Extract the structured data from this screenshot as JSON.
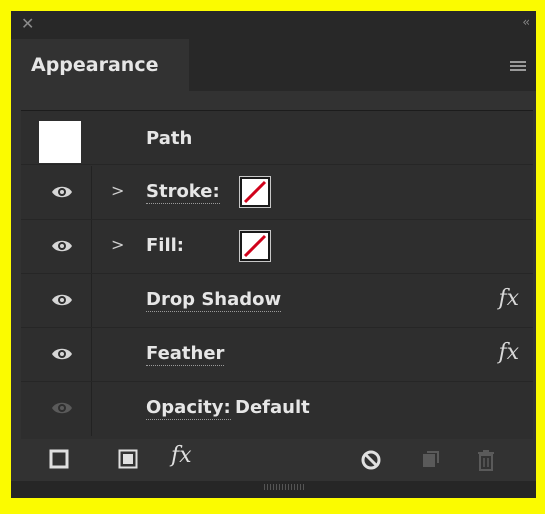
{
  "window": {
    "close_glyph": "✕",
    "collapse_glyph": "‹‹"
  },
  "panel": {
    "tab_label": "Appearance",
    "menu_icon": "hamburger-icon"
  },
  "items": {
    "path": {
      "label": "Path"
    },
    "stroke": {
      "label": "Stroke:",
      "swatch": "none"
    },
    "fill": {
      "label": "Fill:",
      "swatch": "none"
    },
    "drop_shadow": {
      "label": "Drop Shadow",
      "fx": "fx"
    },
    "feather": {
      "label": "Feather",
      "fx": "fx"
    },
    "opacity": {
      "label": "Opacity:",
      "value": "Default"
    }
  },
  "footer": {
    "icons": [
      "add-new-stroke-icon",
      "add-new-fill-icon",
      "add-new-effect-icon",
      "clear-appearance-icon",
      "duplicate-item-icon",
      "delete-item-icon"
    ],
    "fx_label": "fx"
  },
  "colors": {
    "background": "#fbfb00",
    "panel": "#323232",
    "swatch_none_slash": "#d0021b"
  }
}
